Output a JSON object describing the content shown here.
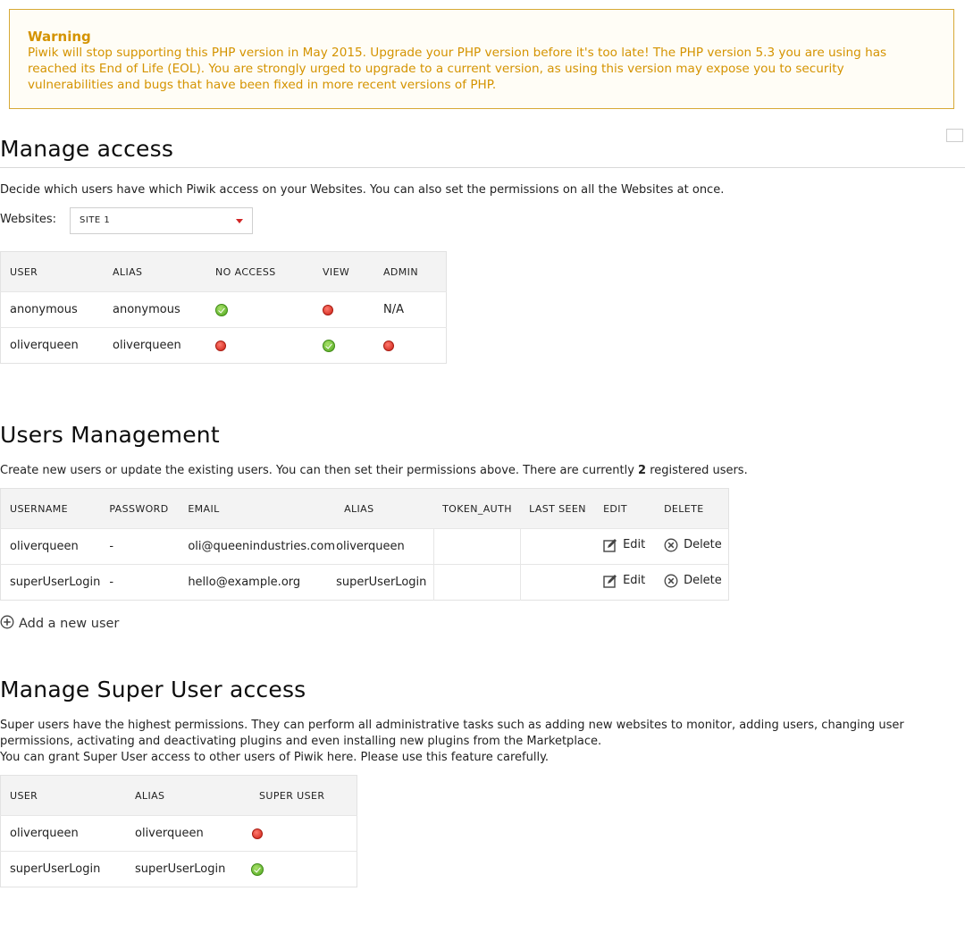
{
  "warning": {
    "title": "Warning",
    "text": "Piwik will stop supporting this PHP version in May 2015. Upgrade your PHP version before it's too late! The PHP version 5.3 you are using has reached its End of Life (EOL). You are strongly urged to upgrade to a current version, as using this version may expose you to security vulnerabilities and bugs that have been fixed in more recent versions of PHP."
  },
  "manage_access": {
    "title": "Manage access",
    "description": "Decide which users have which Piwik access on your Websites. You can also set the permissions on all the Websites at once.",
    "websites_label": "Websites:",
    "selected_site": "SITE 1",
    "columns": [
      "USER",
      "ALIAS",
      "NO ACCESS",
      "VIEW",
      "ADMIN"
    ],
    "rows": [
      {
        "user": "anonymous",
        "alias": "anonymous",
        "no_access": "granted",
        "view": "denied",
        "admin": "N/A"
      },
      {
        "user": "oliverqueen",
        "alias": "oliverqueen",
        "no_access": "denied",
        "view": "granted",
        "admin": "denied"
      }
    ]
  },
  "users_management": {
    "title": "Users Management",
    "description_before": "Create new users or update the existing users. You can then set their permissions above. There are currently ",
    "count": "2",
    "description_after": " registered users.",
    "columns": [
      "USERNAME",
      "PASSWORD",
      "EMAIL",
      "ALIAS",
      "TOKEN_AUTH",
      "LAST SEEN",
      "EDIT",
      "DELETE"
    ],
    "rows": [
      {
        "username": "oliverqueen",
        "password": "-",
        "email": "oli@queenindustries.com",
        "alias": "oliverqueen",
        "token_auth": "",
        "last_seen": "",
        "edit": "Edit",
        "delete": "Delete"
      },
      {
        "username": "superUserLogin",
        "password": "-",
        "email": "hello@example.org",
        "alias": "superUserLogin",
        "token_auth": "",
        "last_seen": "",
        "edit": "Edit",
        "delete": "Delete"
      }
    ],
    "add_user_label": "Add a new user"
  },
  "super_user": {
    "title": "Manage Super User access",
    "description_1": "Super users have the highest permissions. They can perform all administrative tasks such as adding new websites to monitor, adding users, changing user permissions, activating and deactivating plugins and even installing new plugins from the Marketplace.",
    "description_2": "You can grant Super User access to other users of Piwik here. Please use this feature carefully.",
    "columns": [
      "USER",
      "ALIAS",
      "SUPER USER"
    ],
    "rows": [
      {
        "user": "oliverqueen",
        "alias": "oliverqueen",
        "super_user": "denied"
      },
      {
        "user": "superUserLogin",
        "alias": "superUserLogin",
        "super_user": "granted"
      }
    ]
  },
  "colors": {
    "warning": "#d49300",
    "granted": "#4ea51c",
    "denied": "#cc1f14"
  }
}
